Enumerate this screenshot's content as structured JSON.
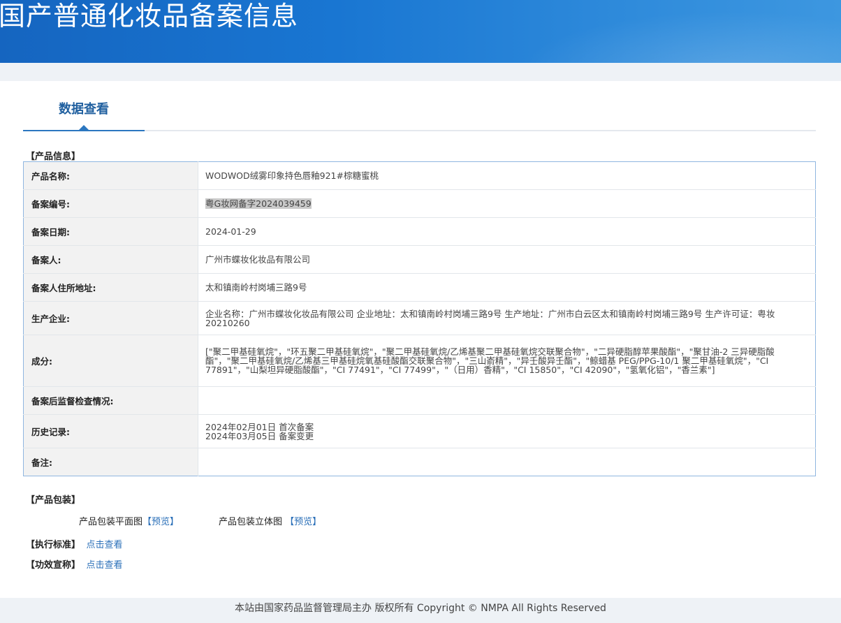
{
  "banner": {
    "title": "国产普通化妆品备案信息"
  },
  "tab": {
    "label": "数据查看"
  },
  "sections": {
    "product_info": "【产品信息】",
    "packaging": "【产品包装】",
    "standard": "【执行标准】",
    "efficacy": "【功效宣称】"
  },
  "rows": [
    {
      "label": "产品名称:",
      "value": "WODWOD绒雾印象持色唇釉921#棕糖蜜桃"
    },
    {
      "label": "备案编号:",
      "value": "粤G妆网备字2024039459"
    },
    {
      "label": "备案日期:",
      "value": "2024-01-29"
    },
    {
      "label": "备案人:",
      "value": "广州市蝶妆化妆品有限公司"
    },
    {
      "label": "备案人住所地址:",
      "value": "太和镇南岭村岗埔三路9号"
    },
    {
      "label": "生产企业:",
      "value": "企业名称：广州市蝶妆化妆品有限公司 企业地址：太和镇南岭村岗埔三路9号 生产地址：广州市白云区太和镇南岭村岗埔三路9号 生产许可证：粤妆20210260"
    },
    {
      "label": "成分:",
      "value": "[\"聚二甲基硅氧烷\"，\"环五聚二甲基硅氧烷\"，\"聚二甲基硅氧烷/乙烯基聚二甲基硅氧烷交联聚合物\"，\"二异硬脂醇苹果酸酯\"，\"聚甘油-2 三异硬脂酸酯\"，\"聚二甲基硅氧烷/乙烯基三甲基硅烷氧基硅酸酯交联聚合物\"，\"三山嵛精\"，\"异壬酸异壬酯\"，\"鲸蜡基 PEG/PPG-10/1 聚二甲基硅氧烷\"，\"CI 77891\"，\"山梨坦异硬脂酸酯\"，\"CI 77491\"，\"CI 77499\"，\"（日用）香精\"，\"CI 15850\"，\"CI 42090\"，\"氢氧化铝\"，\"香兰素\"]"
    },
    {
      "label": "备案后监督检查情况:",
      "value": ""
    },
    {
      "label": "历史记录:",
      "history": [
        "2024年02月01日 首次备案",
        "2024年03月05日 备案变更"
      ]
    },
    {
      "label": "备注:",
      "value": ""
    }
  ],
  "packaging": {
    "flat_label": "产品包装平面图",
    "flat_link": "【预览】",
    "solid_label": "产品包装立体图",
    "solid_link": "【预览】"
  },
  "links": {
    "standard_link": "点击查看",
    "efficacy_link": "点击查看"
  },
  "footer": {
    "text": "本站由国家药品监督管理局主办 版权所有 Copyright © NMPA All Rights Reserved"
  }
}
